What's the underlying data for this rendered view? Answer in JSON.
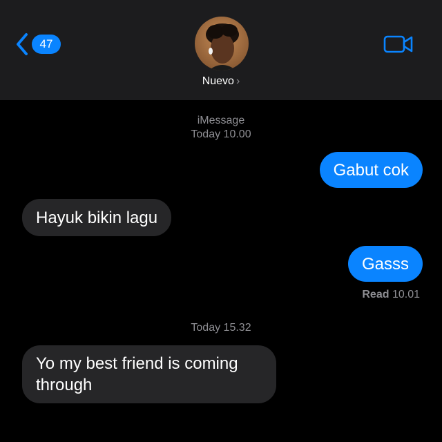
{
  "header": {
    "back_count": "47",
    "contact_name": "Nuevo",
    "contact_chevron": "›"
  },
  "thread": {
    "service": "iMessage",
    "first_time": "Today 10.00",
    "second_time": "Today 15.32"
  },
  "messages": [
    {
      "direction": "sent",
      "text": "Gabut cok"
    },
    {
      "direction": "received",
      "text": "Hayuk bikin lagu"
    },
    {
      "direction": "sent",
      "text": "Gasss"
    },
    {
      "direction": "received",
      "text": "Yo my best friend is coming through"
    }
  ],
  "receipt": {
    "label": "Read",
    "time": "10.01"
  },
  "colors": {
    "accent": "#0a84ff",
    "received_bubble": "#262628",
    "header_bg": "#1c1c1e",
    "meta_text": "#8e8e93"
  },
  "icons": {
    "back": "chevron-left-icon",
    "video": "video-camera-icon"
  }
}
